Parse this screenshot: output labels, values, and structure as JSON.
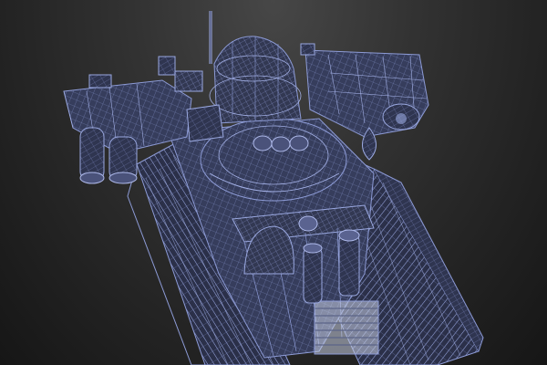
{
  "scene": {
    "subject": "tank-wireframe-model",
    "render_mode": "wireframe",
    "colors": {
      "background_top": "#474747",
      "background_bottom": "#161616",
      "wire": "#8d9bd6",
      "wire_fill": "#3a4160"
    }
  }
}
